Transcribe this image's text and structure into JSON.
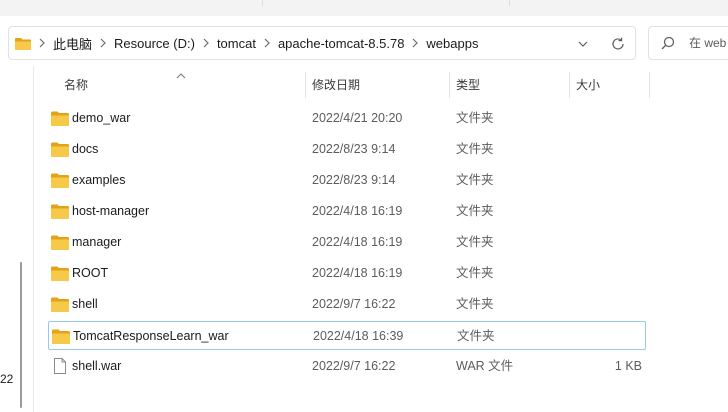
{
  "breadcrumb": [
    "此电脑",
    "Resource (D:)",
    "tomcat",
    "apache-tomcat-8.5.78",
    "webapps"
  ],
  "search": {
    "placeholder": "在 web"
  },
  "columns": {
    "name": "名称",
    "modified": "修改日期",
    "type": "类型",
    "size": "大小"
  },
  "left_cut_text": "22",
  "files": [
    {
      "name": "demo_war",
      "modified": "2022/4/21 20:20",
      "type": "文件夹",
      "size": "",
      "kind": "folder"
    },
    {
      "name": "docs",
      "modified": "2022/8/23 9:14",
      "type": "文件夹",
      "size": "",
      "kind": "folder"
    },
    {
      "name": "examples",
      "modified": "2022/8/23 9:14",
      "type": "文件夹",
      "size": "",
      "kind": "folder"
    },
    {
      "name": "host-manager",
      "modified": "2022/4/18 16:19",
      "type": "文件夹",
      "size": "",
      "kind": "folder"
    },
    {
      "name": "manager",
      "modified": "2022/4/18 16:19",
      "type": "文件夹",
      "size": "",
      "kind": "folder"
    },
    {
      "name": "ROOT",
      "modified": "2022/4/18 16:19",
      "type": "文件夹",
      "size": "",
      "kind": "folder"
    },
    {
      "name": "shell",
      "modified": "2022/9/7 16:22",
      "type": "文件夹",
      "size": "",
      "kind": "folder"
    },
    {
      "name": "TomcatResponseLearn_war",
      "modified": "2022/4/18 16:39",
      "type": "文件夹",
      "size": "",
      "kind": "folder"
    },
    {
      "name": "shell.war",
      "modified": "2022/9/7 16:22",
      "type": "WAR 文件",
      "size": "1 KB",
      "kind": "file"
    }
  ],
  "icons": {
    "folder": "folder-icon",
    "file": "file-icon",
    "search": "search-icon",
    "refresh": "refresh-icon",
    "dropdown": "chevron-down-icon",
    "separator": "chevron-right-icon",
    "sort": "sort-ascending-icon"
  },
  "colors": {
    "folder": "#f7c948",
    "folder_dark": "#e3a21a",
    "selection_border": "#99c8ef"
  }
}
